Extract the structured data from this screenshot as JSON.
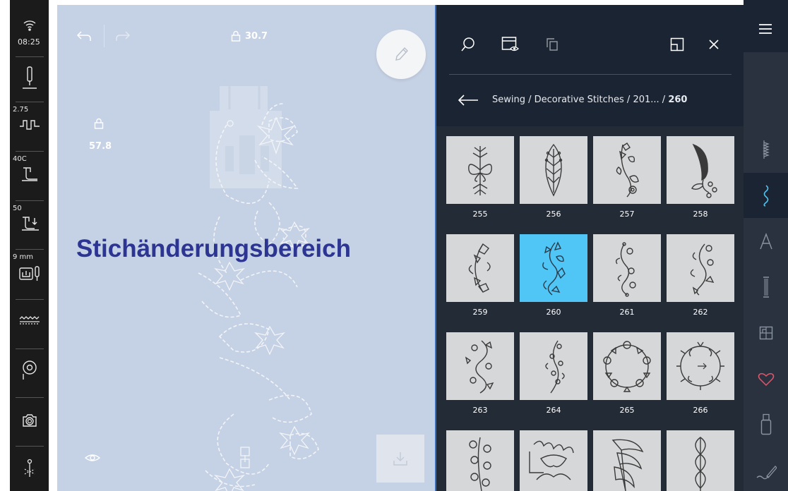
{
  "status": {
    "time": "08:25"
  },
  "left_bar": {
    "needle_label": "",
    "stitch_width": "2.75",
    "presser_foot": "40C",
    "presser_pressure": "50",
    "needle_size": "9 mm"
  },
  "canvas": {
    "area_label": "Stichänderungsbereich",
    "lock_top_value": "30.7",
    "lock_left_value": "57.8"
  },
  "panel": {
    "breadcrumb_path": "Sewing / Decorative Stitches / 201... / ",
    "breadcrumb_current": "260"
  },
  "stitches": [
    {
      "number": "255",
      "selected": false
    },
    {
      "number": "256",
      "selected": false
    },
    {
      "number": "257",
      "selected": false
    },
    {
      "number": "258",
      "selected": false
    },
    {
      "number": "259",
      "selected": false
    },
    {
      "number": "260",
      "selected": true
    },
    {
      "number": "261",
      "selected": false
    },
    {
      "number": "262",
      "selected": false
    },
    {
      "number": "263",
      "selected": false
    },
    {
      "number": "264",
      "selected": false
    },
    {
      "number": "265",
      "selected": false
    },
    {
      "number": "266",
      "selected": false
    }
  ],
  "colors": {
    "canvas_bg": "#c5d1e4",
    "panel_bg": "#1b2433",
    "selected_tile": "#4fc6f5",
    "label_color": "#2d3593",
    "accent_cyan": "#4fc6f5",
    "favorite_red": "#e0566b"
  }
}
